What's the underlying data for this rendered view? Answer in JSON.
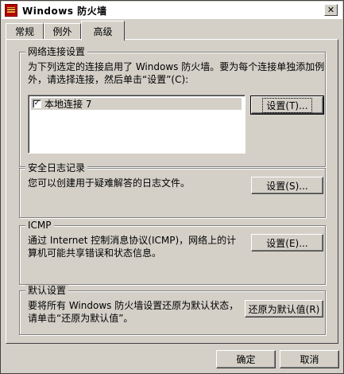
{
  "window": {
    "title": "Windows 防火墙",
    "close_glyph": "✕"
  },
  "tabs": [
    {
      "label": "常规"
    },
    {
      "label": "例外"
    },
    {
      "label": "高级",
      "active": true
    }
  ],
  "network": {
    "title": "网络连接设置",
    "description": "为下列选定的连接启用了 Windows 防火墙。要为每个连接单独添加例\n外，请选择连接，然后单击“设置”(C):",
    "connections": [
      {
        "label": "本地连接 7",
        "checked": true
      }
    ],
    "check_glyph": "✓",
    "settings_button": "设置(T)..."
  },
  "log": {
    "title": "安全日志记录",
    "description": "您可以创建用于疑难解答的日志文件。",
    "settings_button": "设置(S)..."
  },
  "icmp": {
    "title": "ICMP",
    "description": "通过 Internet 控制消息协议(ICMP)，网络上的计\n算机可能共享错误和状态信息。",
    "settings_button": "设置(E)..."
  },
  "defaults": {
    "title": "默认设置",
    "description": "要将所有 Windows 防火墙设置还原为默认状态，\n请单击“还原为默认值”。",
    "restore_button": "还原为默认值(R)"
  },
  "footer": {
    "ok_button": "确定",
    "cancel_button": "取消"
  }
}
